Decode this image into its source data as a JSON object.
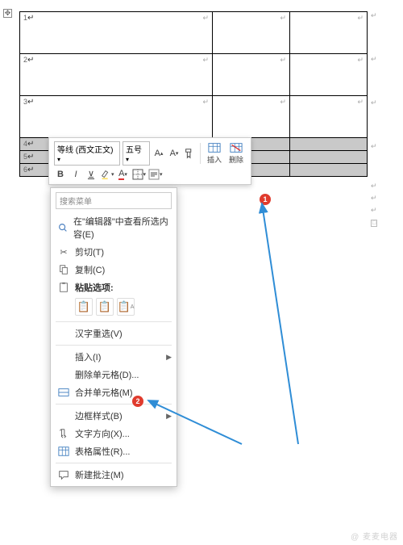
{
  "table": {
    "rows": [
      {
        "cells": [
          "1",
          "",
          ""
        ],
        "thin": false
      },
      {
        "cells": [
          "2",
          "",
          ""
        ],
        "thin": false
      },
      {
        "cells": [
          "3",
          "",
          ""
        ],
        "thin": false
      },
      {
        "cells": [
          "4",
          "",
          ""
        ],
        "thin": true
      },
      {
        "cells": [
          "5",
          "",
          ""
        ],
        "thin": true
      },
      {
        "cells": [
          "6",
          "",
          ""
        ],
        "thin": true
      }
    ]
  },
  "miniToolbar": {
    "font": "等线 (西文正文)",
    "size": "五号",
    "insert": "插入",
    "delete": "删除"
  },
  "ctx": {
    "search_placeholder": "搜索菜单",
    "lookup": "在\"编辑器\"中查看所选内容(E)",
    "cut": "剪切(T)",
    "copy": "复制(C)",
    "paste_label": "粘贴选项:",
    "hanzi": "汉字重选(V)",
    "insert": "插入(I)",
    "delete_cells": "删除单元格(D)...",
    "merge": "合并单元格(M)",
    "border": "边框样式(B)",
    "text_dir": "文字方向(X)...",
    "table_props": "表格属性(R)...",
    "new_comment": "新建批注(M)"
  },
  "badges": {
    "one": "1",
    "two": "2"
  },
  "watermark": "@ 麦麦电器"
}
